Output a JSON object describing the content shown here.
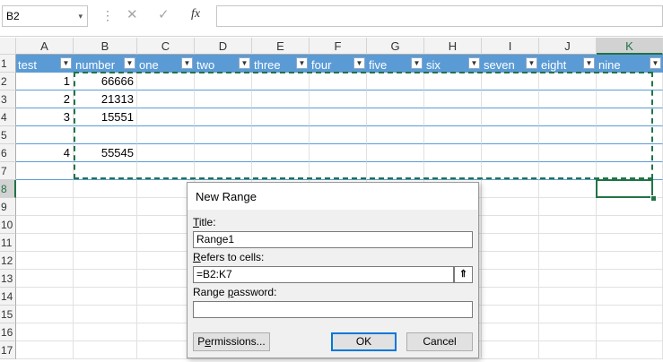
{
  "formula_bar": {
    "name_box": "B2",
    "name_box_arrow": "▾",
    "dots": "⋮",
    "cancel_glyph": "✕",
    "enter_glyph": "✓",
    "fx_label": "fx",
    "formula": ""
  },
  "columns": [
    "A",
    "B",
    "C",
    "D",
    "E",
    "F",
    "G",
    "H",
    "I",
    "J",
    "K"
  ],
  "rows": [
    "1",
    "2",
    "3",
    "4",
    "5",
    "6",
    "7",
    "8",
    "9",
    "10",
    "11",
    "12",
    "13",
    "14",
    "15",
    "16",
    "17"
  ],
  "table": {
    "headers": [
      "test",
      "number",
      "one",
      "two",
      "three",
      "four",
      "five",
      "six",
      "seven",
      "eight",
      "nine"
    ],
    "dropdown_glyph": "▼",
    "rows": [
      [
        "1",
        "66666",
        "",
        "",
        "",
        "",
        "",
        "",
        "",
        "",
        ""
      ],
      [
        "2",
        "21313",
        "",
        "",
        "",
        "",
        "",
        "",
        "",
        "",
        ""
      ],
      [
        "3",
        "15551",
        "",
        "",
        "",
        "",
        "",
        "",
        "",
        "",
        ""
      ],
      [
        "",
        "",
        "",
        "",
        "",
        "",
        "",
        "",
        "",
        "",
        ""
      ],
      [
        "4",
        "55545",
        "",
        "",
        "",
        "",
        "",
        "",
        "",
        "",
        ""
      ],
      [
        "",
        "",
        "",
        "",
        "",
        "",
        "",
        "",
        "",
        "",
        ""
      ]
    ]
  },
  "selection": {
    "active_cell": "K8",
    "copy_range": "B2:K7"
  },
  "dialog": {
    "title": "New Range",
    "title_label_pre": "",
    "title_label_key": "T",
    "title_label_post": "itle:",
    "title_value": "Range1",
    "refers_label_key": "R",
    "refers_label_post": "efers to cells:",
    "refers_value": "=B2:K7",
    "collapse_glyph": "⇑",
    "password_label_pre": "Range ",
    "password_label_key": "p",
    "password_label_post": "assword:",
    "password_value": "",
    "permissions_pre": "P",
    "permissions_key": "e",
    "permissions_post": "rmissions...",
    "ok": "OK",
    "cancel": "Cancel"
  },
  "colors": {
    "accent": "#217346",
    "table_header": "#5b9bd5",
    "band_line": "#5b9bd5"
  }
}
